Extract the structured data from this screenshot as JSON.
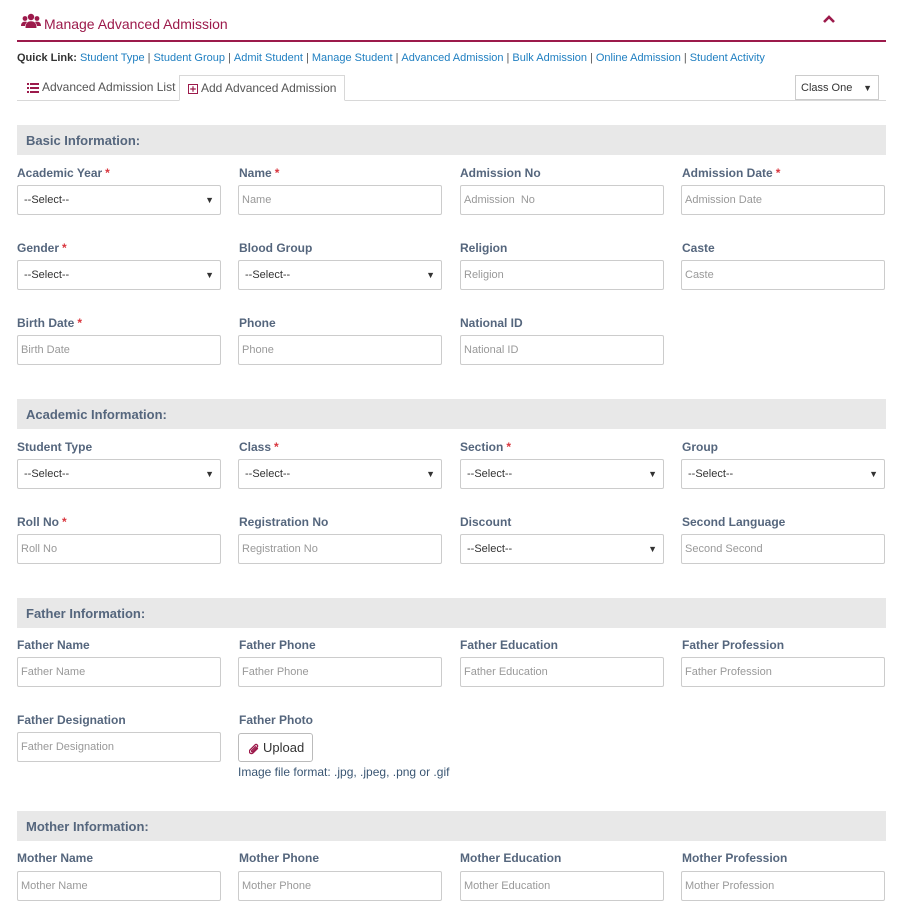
{
  "header": {
    "title": "Manage Advanced Admission",
    "icon": "users-icon",
    "collapse_icon": "chevron-up-icon",
    "accent": "#9c1a4b"
  },
  "quick_links": {
    "label": "Quick Link:",
    "items": [
      "Student Type",
      "Student Group",
      "Admit Student",
      "Manage Student",
      "Advanced Admission",
      "Bulk Admission",
      "Online Admission",
      "Student Activity"
    ]
  },
  "tabs": [
    {
      "label": "Advanced Admission List",
      "icon": "list-icon",
      "active": false
    },
    {
      "label": "Add Advanced Admission",
      "icon": "plus-square-icon",
      "active": true
    }
  ],
  "class_filter": {
    "value": "Class One"
  },
  "sections": {
    "basic": "Basic Information:",
    "academic": "Academic Information:",
    "father": "Father Information:",
    "mother": "Mother Information:"
  },
  "fields": {
    "academic_year": {
      "label": "Academic Year",
      "required": "*",
      "value": "--Select--"
    },
    "name": {
      "label": "Name",
      "required": "*",
      "placeholder": "Name"
    },
    "admission_no": {
      "label": "Admission No",
      "placeholder": "Admission  No"
    },
    "admission_date": {
      "label": "Admission Date",
      "required": "*",
      "placeholder": "Admission Date"
    },
    "gender": {
      "label": "Gender",
      "required": "*",
      "value": "--Select--"
    },
    "blood_group": {
      "label": "Blood Group",
      "value": "--Select--"
    },
    "religion": {
      "label": "Religion",
      "placeholder": "Religion"
    },
    "caste": {
      "label": "Caste",
      "placeholder": "Caste"
    },
    "birth_date": {
      "label": "Birth Date",
      "required": "*",
      "placeholder": "Birth Date"
    },
    "phone": {
      "label": "Phone",
      "placeholder": "Phone"
    },
    "national_id": {
      "label": "National ID",
      "placeholder": "National ID"
    },
    "student_type": {
      "label": "Student Type",
      "value": "--Select--"
    },
    "class": {
      "label": "Class",
      "required": "*",
      "value": "--Select--"
    },
    "section": {
      "label": "Section",
      "required": "*",
      "value": "--Select--"
    },
    "group": {
      "label": "Group",
      "value": "--Select--"
    },
    "roll_no": {
      "label": "Roll No",
      "required": "*",
      "placeholder": "Roll No"
    },
    "registration_no": {
      "label": "Registration No",
      "placeholder": "Registration No"
    },
    "discount": {
      "label": "Discount",
      "value": "--Select--"
    },
    "second_language": {
      "label": "Second Language",
      "placeholder": "Second Second"
    },
    "father_name": {
      "label": "Father Name",
      "placeholder": "Father Name"
    },
    "father_phone": {
      "label": "Father Phone",
      "placeholder": "Father Phone"
    },
    "father_education": {
      "label": "Father Education",
      "placeholder": "Father Education"
    },
    "father_profession": {
      "label": "Father Profession",
      "placeholder": "Father Profession"
    },
    "father_designation": {
      "label": "Father Designation",
      "placeholder": "Father Designation"
    },
    "father_photo": {
      "label": "Father Photo",
      "button": "Upload",
      "hint": "Image file format: .jpg, .jpeg, .png or .gif"
    },
    "mother_name": {
      "label": "Mother Name",
      "placeholder": "Mother Name"
    },
    "mother_phone": {
      "label": "Mother Phone",
      "placeholder": "Mother Phone"
    },
    "mother_education": {
      "label": "Mother Education",
      "placeholder": "Mother Education"
    },
    "mother_profession": {
      "label": "Mother Profession",
      "placeholder": "Mother Profession"
    }
  }
}
